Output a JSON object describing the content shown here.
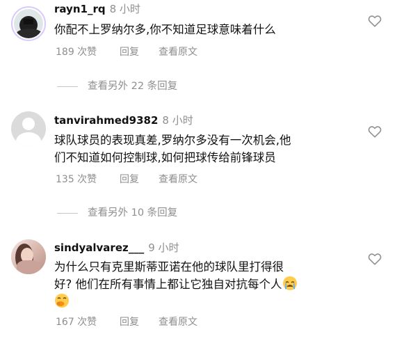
{
  "comments": [
    {
      "username": "rayn1_rq",
      "time": "8 小时",
      "lines": [
        "你配不上罗纳尔多,你不知道足球意味着什么"
      ],
      "likes": "189 次赞",
      "reply": "回复",
      "translate": "查看原文"
    },
    {
      "username": "tanvirahmed9382",
      "time": "8 小时",
      "lines": [
        "球队球员的表现真差,罗纳尔多没有一次机会,他",
        "们不知道如何控制球,如何把球传给前锋球员"
      ],
      "likes": "135 次赞",
      "reply": "回复",
      "translate": "查看原文"
    },
    {
      "username": "sindyalvarez___",
      "time": "9 小时",
      "lines": [
        "为什么只有克里斯蒂亚诺在他的球队里打得很",
        "好? 他们在所有事情上都让它独自对抗每个人"
      ],
      "likes": "167 次赞",
      "reply": "回复",
      "translate": "查看原文"
    }
  ],
  "view_replies": [
    "查看另外 22 条回复",
    "查看另外 10 条回复"
  ],
  "icons": [
    "heart-icon",
    "crying-face-icon",
    "face-with-hand-over-mouth-icon"
  ]
}
